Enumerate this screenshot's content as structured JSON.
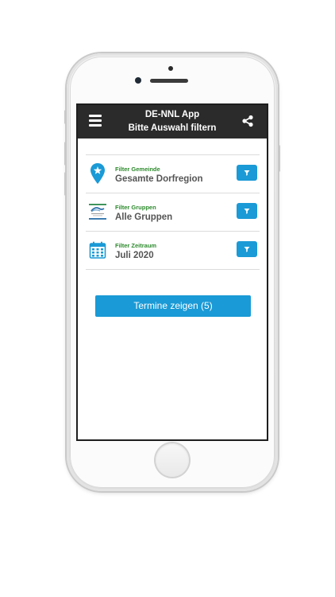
{
  "header": {
    "title": "DE-NNL App",
    "subtitle": "Bitte Auswahl filtern",
    "menu_icon": "hamburger-menu-icon",
    "share_icon": "share-icon"
  },
  "filters": [
    {
      "label": "Filter Gemeinde",
      "value": "Gesamte Dorfregion",
      "icon": "location-pin-star-icon",
      "button_icon": "funnel-icon"
    },
    {
      "label": "Filter Gruppen",
      "value": "Alle Gruppen",
      "icon": "group-logo-icon",
      "button_icon": "funnel-icon"
    },
    {
      "label": "Filter Zeitraum",
      "value": "Juli 2020",
      "icon": "calendar-icon",
      "button_icon": "funnel-icon"
    }
  ],
  "actions": {
    "show_events_label": "Termine zeigen (5)"
  },
  "colors": {
    "header_bg": "#2b2b2b",
    "accent_blue": "#1a9ad6",
    "label_green": "#2d8a2d",
    "value_gray": "#555555"
  }
}
